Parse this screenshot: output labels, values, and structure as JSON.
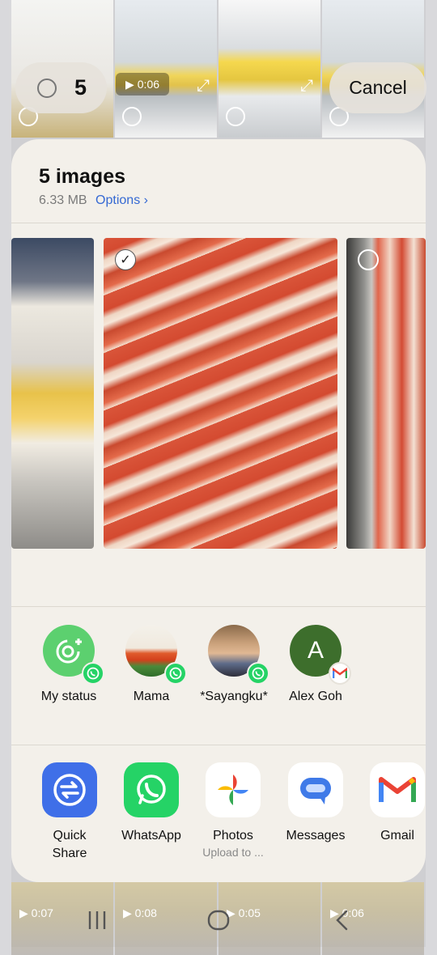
{
  "top_bar": {
    "selected_count": "5",
    "video_duration": "0:06",
    "cancel_label": "Cancel"
  },
  "sheet": {
    "title": "5 images",
    "size": "6.33 MB",
    "options_label": "Options",
    "options_chevron": "›"
  },
  "contacts": [
    {
      "name": "My status",
      "badge_icon": "whatsapp-icon"
    },
    {
      "name": "Mama",
      "badge_icon": "whatsapp-icon"
    },
    {
      "name": "*Sayangku*",
      "badge_icon": "whatsapp-icon"
    },
    {
      "name": "Alex Goh",
      "initial": "A",
      "badge_icon": "gmail-icon"
    }
  ],
  "apps": [
    {
      "label": "Quick\nShare",
      "sub": ""
    },
    {
      "label": "WhatsApp",
      "sub": ""
    },
    {
      "label": "Photos",
      "sub": "Upload to ..."
    },
    {
      "label": "Messages",
      "sub": ""
    },
    {
      "label": "Gmail",
      "sub": ""
    }
  ],
  "background_videos": [
    "0:07",
    "0:08",
    "0:05",
    "0:06"
  ],
  "colors": {
    "whatsapp_green": "#25D366",
    "quick_share_blue": "#3f6fe8",
    "link_blue": "#3569d3",
    "alex_avatar_green": "#3d6e2c"
  }
}
